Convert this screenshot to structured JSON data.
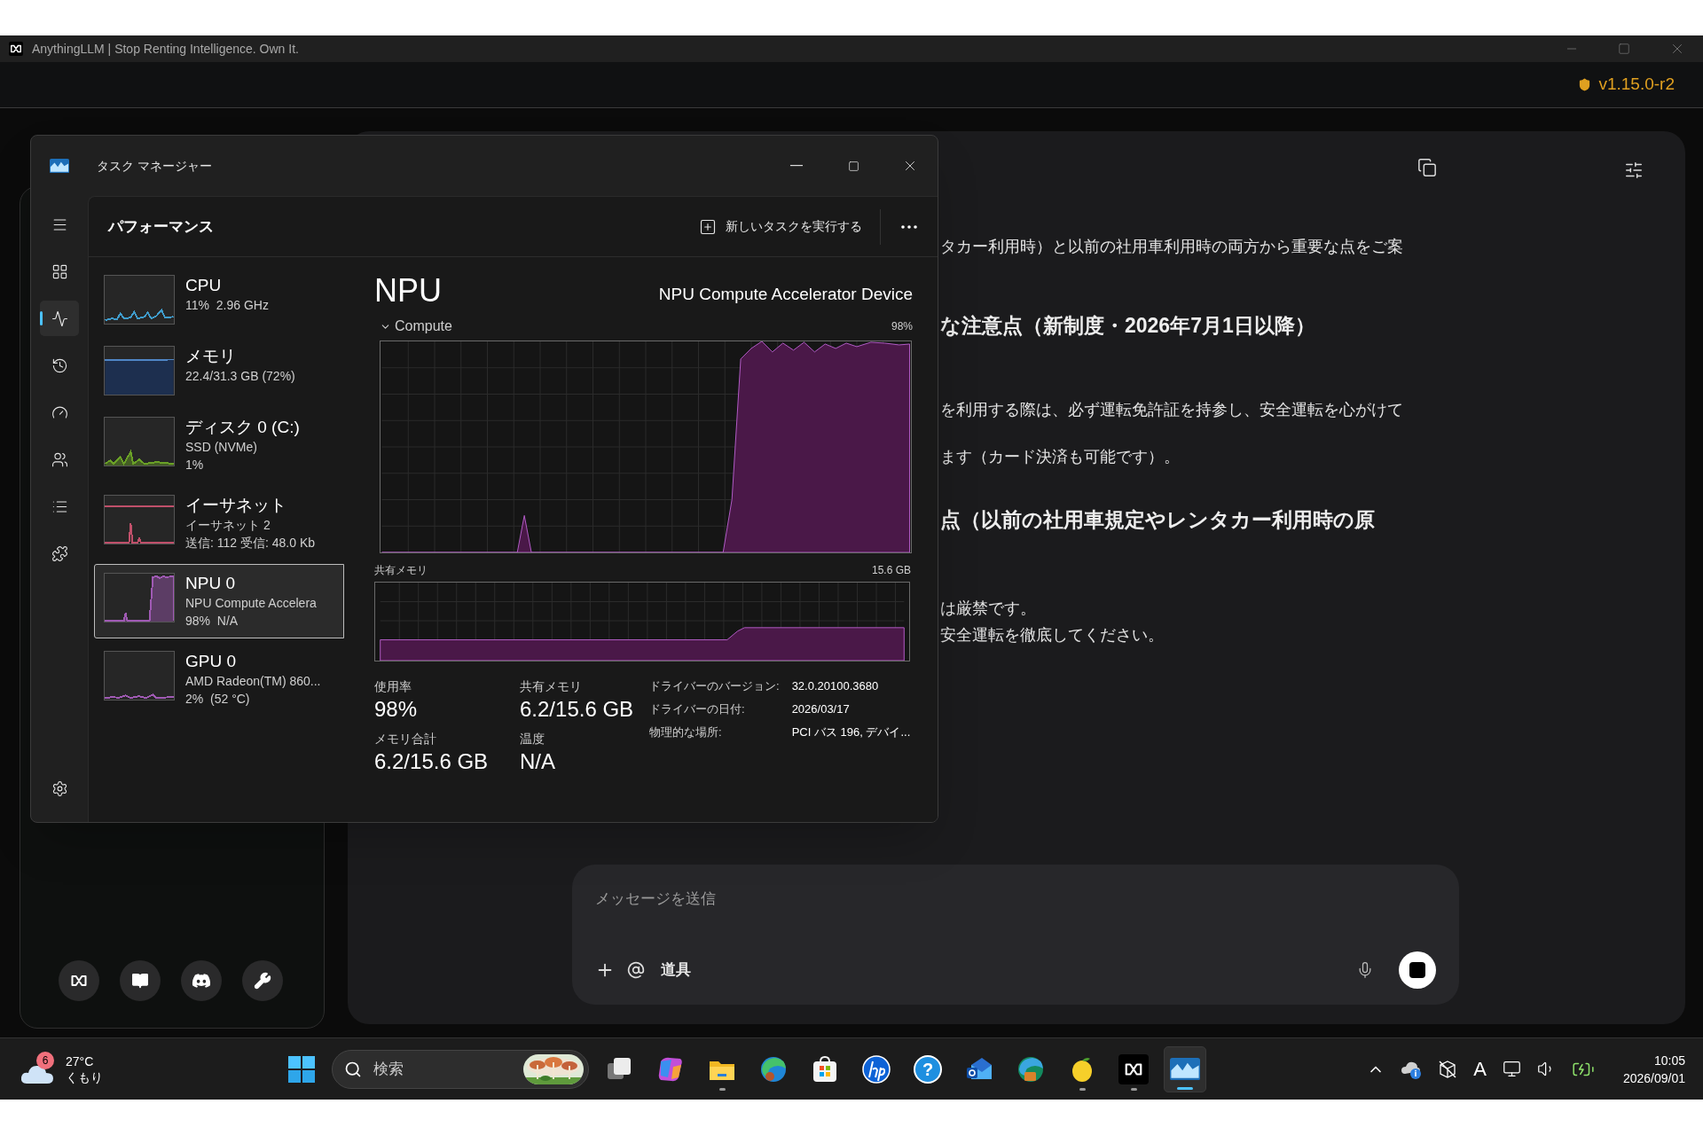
{
  "app_window": {
    "title": "AnythingLLM | Stop Renting Intelligence. Own It.",
    "version": "v1.15.0-r2"
  },
  "sidebar": {
    "buttons": [
      {
        "kind": "logo"
      },
      {
        "kind": "docs"
      },
      {
        "kind": "discord"
      },
      {
        "kind": "tools"
      }
    ]
  },
  "chat": {
    "lines": [
      {
        "kind": "paragraph",
        "text": "タカー利用時）と以前の社用車利用時の両方から重要な点をご案"
      },
      {
        "kind": "heading",
        "text": "な注意点（新制度・2026年7月1日以降）"
      },
      {
        "kind": "paragraph",
        "text": "を利用する際は、必ず運転免許証を持参し、安全運転を心がけて"
      },
      {
        "kind": "paragraph",
        "text": "ます（カード決済も可能です）。"
      },
      {
        "kind": "heading",
        "text": "点（以前の社用車規定やレンタカー利用時の原"
      },
      {
        "kind": "paragraph",
        "text": "は厳禁です。"
      },
      {
        "kind": "paragraph",
        "text": "安全運転を徹底してください。"
      }
    ],
    "composer": {
      "placeholder": "メッセージを送信",
      "tools_label": "道具"
    }
  },
  "task_manager": {
    "title": "タスク マネージャー",
    "page_title": "パフォーマンス",
    "run_task": "新しいタスクを実行する",
    "nav": [
      {
        "kind": "menu",
        "selected": false
      },
      {
        "kind": "processes",
        "selected": false
      },
      {
        "kind": "performance",
        "selected": true
      },
      {
        "kind": "history",
        "selected": false
      },
      {
        "kind": "startup",
        "selected": false
      },
      {
        "kind": "users",
        "selected": false
      },
      {
        "kind": "details",
        "selected": false
      },
      {
        "kind": "services",
        "selected": false
      }
    ],
    "devices": [
      {
        "kind": "cpu",
        "name": "CPU",
        "details": [
          "11%  2.96 GHz"
        ],
        "color": "#3f9ccc",
        "selected": false
      },
      {
        "kind": "memory",
        "name": "メモリ",
        "details": [
          "22.4/31.3 GB (72%)"
        ],
        "color": "#4f86c6",
        "selected": false
      },
      {
        "kind": "disk",
        "name": "ディスク 0 (C:)",
        "details": [
          "SSD (NVMe)",
          "1%"
        ],
        "color": "#6aa126",
        "selected": false
      },
      {
        "kind": "ethernet",
        "name": "イーサネット",
        "details": [
          "イーサネット 2",
          "送信: 112 受信: 48.0 Kb"
        ],
        "color": "#c0506a",
        "selected": false
      },
      {
        "kind": "npu",
        "name": "NPU 0",
        "details": [
          "NPU Compute Accelera",
          "98%  N/A"
        ],
        "color": "#a05ab4",
        "selected": true
      },
      {
        "kind": "gpu",
        "name": "GPU 0",
        "details": [
          "AMD Radeon(TM) 860...",
          "2%  (52 °C)"
        ],
        "color": "#a05ab4",
        "selected": false
      }
    ],
    "detail": {
      "heading": "NPU",
      "device_name": "NPU Compute Accelerator Device",
      "graph_label": "Compute",
      "graph_max": "98%",
      "memory_label": "共有メモリ",
      "memory_max": "15.6 GB",
      "stats": [
        {
          "label": "使用率",
          "value": "98%"
        },
        {
          "label": "共有メモリ",
          "value": "6.2/15.6 GB"
        },
        {
          "label": "メモリ合計",
          "value": "6.2/15.6 GB"
        },
        {
          "label": "温度",
          "value": "N/A"
        }
      ],
      "properties": [
        {
          "label": "ドライバーのバージョン:",
          "value": "32.0.20100.3680"
        },
        {
          "label": "ドライバーの日付:",
          "value": "2026/03/17"
        },
        {
          "label": "物理的な場所:",
          "value": "PCI バス 196, デバイ..."
        }
      ]
    }
  },
  "taskbar": {
    "weather": {
      "badge": "6",
      "temperature": "27°C",
      "condition": "くもり"
    },
    "search_placeholder": "検索",
    "apps": [
      {
        "kind": "task-view",
        "running": false,
        "active": false
      },
      {
        "kind": "copilot",
        "running": false,
        "active": false
      },
      {
        "kind": "folder",
        "running": true,
        "active": false
      },
      {
        "kind": "edge",
        "running": false,
        "active": false
      },
      {
        "kind": "store",
        "running": false,
        "active": false
      },
      {
        "kind": "hp",
        "running": false,
        "active": false
      },
      {
        "kind": "help",
        "glyph": "?",
        "running": false,
        "active": false
      },
      {
        "kind": "outlook",
        "running": false,
        "active": false
      },
      {
        "kind": "edge-dev",
        "running": false,
        "active": false
      },
      {
        "kind": "lemon",
        "running": true,
        "active": false
      },
      {
        "kind": "anythingllm",
        "running": true,
        "active": false
      },
      {
        "kind": "taskmgr",
        "running": true,
        "active": true
      }
    ],
    "ime": "A",
    "time": "10:05",
    "date": "2026/09/01"
  }
}
